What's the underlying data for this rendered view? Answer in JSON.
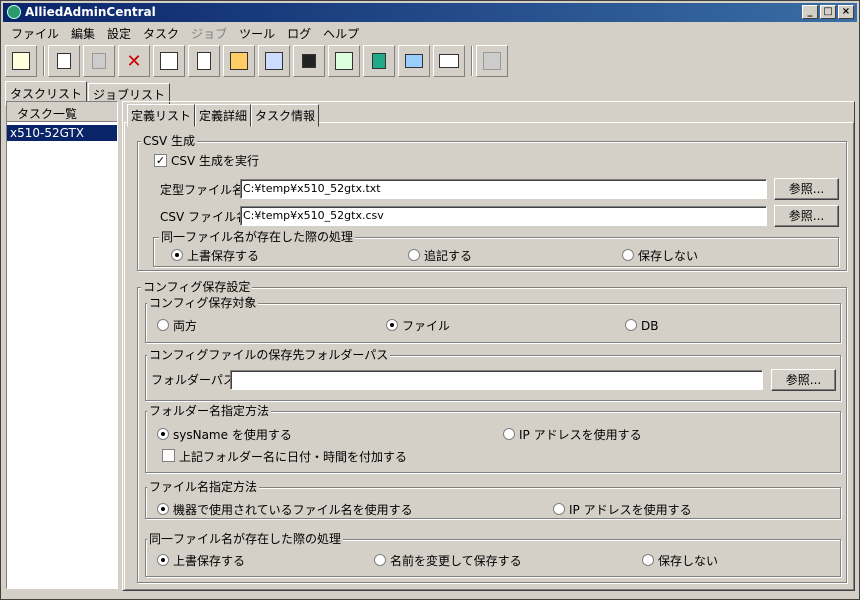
{
  "window": {
    "title": "AlliedAdminCentral",
    "controls": [
      "_",
      "□",
      "×"
    ]
  },
  "menu": [
    "ファイル",
    "編集",
    "設定",
    "タスク",
    "ジョブ",
    "ツール",
    "ログ",
    "ヘルプ"
  ],
  "menu_disabled": [
    false,
    false,
    false,
    false,
    true,
    false,
    false,
    false
  ],
  "toolbar": [
    "import-icon",
    "copy-icon",
    "paste-icon",
    "delete-icon",
    "task-icon",
    "new-icon",
    "folder-icon",
    "transfer-icon",
    "save-icon",
    "schedule-icon",
    "panel-icon",
    "device-icon",
    "log-icon",
    "agent-icon"
  ],
  "outer_tabs": {
    "task_list": "タスクリスト",
    "job_list": "ジョブリスト"
  },
  "left": {
    "header": "タスク一覧",
    "items": [
      "x510-52GTX"
    ]
  },
  "inner_tabs": {
    "definition_list": "定義リスト",
    "definition_detail": "定義詳細",
    "task_info": "タスク情報"
  },
  "csv": {
    "legend": "CSV 生成",
    "enable_label": "CSV 生成を実行",
    "template_label": "定型ファイル名:",
    "template_value": "C:¥temp¥x510_52gtx.txt",
    "csv_label": "CSV ファイル名:",
    "csv_value": "C:¥temp¥x510_52gtx.csv",
    "browse": "参照...",
    "dup_legend": "同一ファイル名が存在した際の処理",
    "dup_opts": [
      "上書保存する",
      "追記する",
      "保存しない"
    ]
  },
  "config": {
    "legend": "コンフィグ保存設定",
    "target_legend": "コンフィグ保存対象",
    "target_opts": [
      "両方",
      "ファイル",
      "DB"
    ],
    "folder_legend": "コンフィグファイルの保存先フォルダーパス",
    "folder_label": "フォルダーパス:",
    "folder_value": "",
    "browse": "参照...",
    "fname_legend": "フォルダー名指定方法",
    "fname_opts": [
      "sysName を使用する",
      "IP アドレスを使用する"
    ],
    "fname_check": "上記フォルダー名に日付・時間を付加する",
    "file_legend": "ファイル名指定方法",
    "file_opts": [
      "機器で使用されているファイル名を使用する",
      "IP アドレスを使用する"
    ],
    "dup_legend": "同一ファイル名が存在した際の処理",
    "dup_opts": [
      "上書保存する",
      "名前を変更して保存する",
      "保存しない"
    ]
  }
}
